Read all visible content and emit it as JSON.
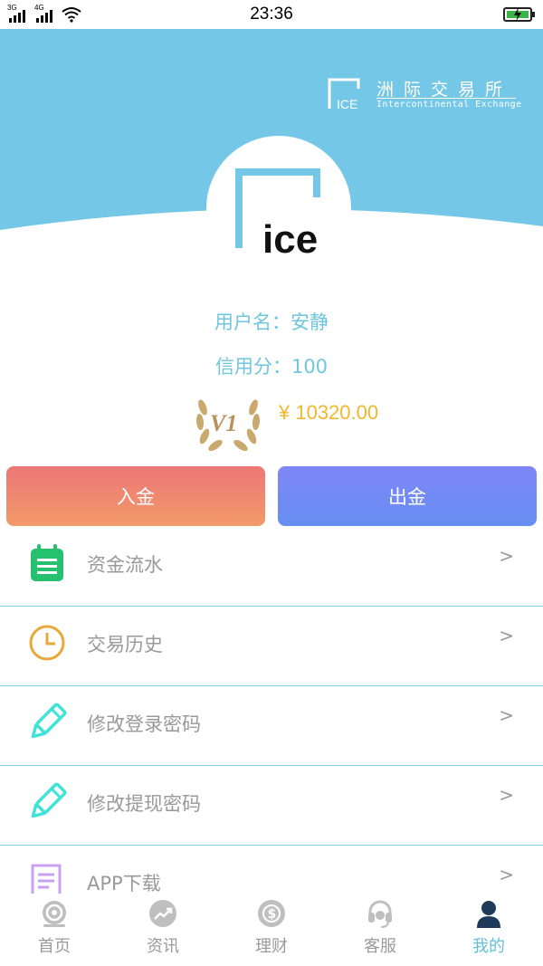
{
  "status_bar": {
    "network1": "3G",
    "network2": "4G",
    "time": "23:36"
  },
  "brand": {
    "mark_text": "ICE",
    "name_cn": "洲际交易所",
    "name_en": "Intercontinental Exchange"
  },
  "logo": {
    "text": "ice"
  },
  "profile": {
    "username": "用户名：安静",
    "credit": "信用分：100",
    "vip_level": "V1",
    "balance": "¥ 10320.00"
  },
  "actions": {
    "deposit_label": "入金",
    "withdraw_label": "出金"
  },
  "menu": [
    {
      "label": "资金流水",
      "icon": "notepad-icon",
      "arrow": ">"
    },
    {
      "label": "交易历史",
      "icon": "clock-icon",
      "arrow": ">"
    },
    {
      "label": "修改登录密码",
      "icon": "pencil-icon",
      "arrow": ">"
    },
    {
      "label": "修改提现密码",
      "icon": "pencil-icon",
      "arrow": ">"
    },
    {
      "label": "APP下载",
      "icon": "document-icon",
      "arrow": ">"
    }
  ],
  "tabs": [
    {
      "label": "首页",
      "icon": "home-icon",
      "active": false
    },
    {
      "label": "资讯",
      "icon": "trend-icon",
      "active": false
    },
    {
      "label": "理财",
      "icon": "money-icon",
      "active": false
    },
    {
      "label": "客服",
      "icon": "headset-icon",
      "active": false
    },
    {
      "label": "我的",
      "icon": "user-icon",
      "active": true
    }
  ],
  "colors": {
    "header_bg": "#74c7e6",
    "accent": "#62bfdc",
    "balance": "#f1b82d",
    "divider": "#7ccde0"
  }
}
